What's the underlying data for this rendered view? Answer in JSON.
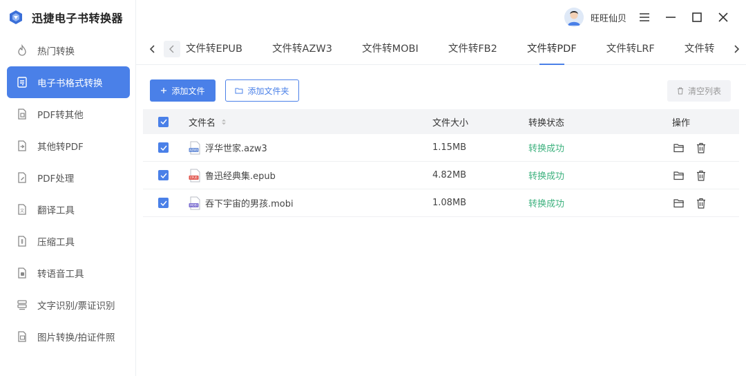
{
  "app": {
    "title": "迅捷电子书转换器"
  },
  "sidebar": {
    "items": [
      {
        "label": "热门转换",
        "icon": "fire-icon",
        "active": false
      },
      {
        "label": "电子书格式转换",
        "icon": "ebook-convert-icon",
        "active": true
      },
      {
        "label": "PDF转其他",
        "icon": "pdf-to-other-icon",
        "active": false
      },
      {
        "label": "其他转PDF",
        "icon": "other-to-pdf-icon",
        "active": false
      },
      {
        "label": "PDF处理",
        "icon": "pdf-process-icon",
        "active": false
      },
      {
        "label": "翻译工具",
        "icon": "translate-icon",
        "active": false
      },
      {
        "label": "压缩工具",
        "icon": "compress-icon",
        "active": false
      },
      {
        "label": "转语音工具",
        "icon": "speech-icon",
        "active": false
      },
      {
        "label": "文字识别/票证识别",
        "icon": "ocr-icon",
        "active": false
      },
      {
        "label": "图片转换/拍证件照",
        "icon": "image-convert-icon",
        "active": false
      }
    ]
  },
  "user": {
    "name": "旺旺仙贝"
  },
  "tabs": [
    {
      "label": "文件转EPUB",
      "active": false
    },
    {
      "label": "文件转AZW3",
      "active": false
    },
    {
      "label": "文件转MOBI",
      "active": false
    },
    {
      "label": "文件转FB2",
      "active": false
    },
    {
      "label": "文件转PDF",
      "active": true
    },
    {
      "label": "文件转LRF",
      "active": false
    },
    {
      "label": "文件转",
      "active": false
    }
  ],
  "toolbar": {
    "add_file": "添加文件",
    "add_folder": "添加文件夹",
    "clear_list": "清空列表"
  },
  "table": {
    "headers": {
      "name": "文件名",
      "size": "文件大小",
      "status": "转换状态",
      "ops": "操作"
    },
    "rows": [
      {
        "name": "浮华世家.azw3",
        "badge": "AZW3",
        "badge_color": "#6a8fd8",
        "size": "1.15MB",
        "status": "转换成功"
      },
      {
        "name": "鲁迅经典集.epub",
        "badge": "EPUB",
        "badge_color": "#e0524a",
        "size": "4.82MB",
        "status": "转换成功"
      },
      {
        "name": "吞下宇宙的男孩.mobi",
        "badge": "MOBI",
        "badge_color": "#7c6fd0",
        "size": "1.08MB",
        "status": "转换成功"
      }
    ]
  },
  "colors": {
    "accent": "#4a80e8",
    "success": "#3fb27f"
  }
}
